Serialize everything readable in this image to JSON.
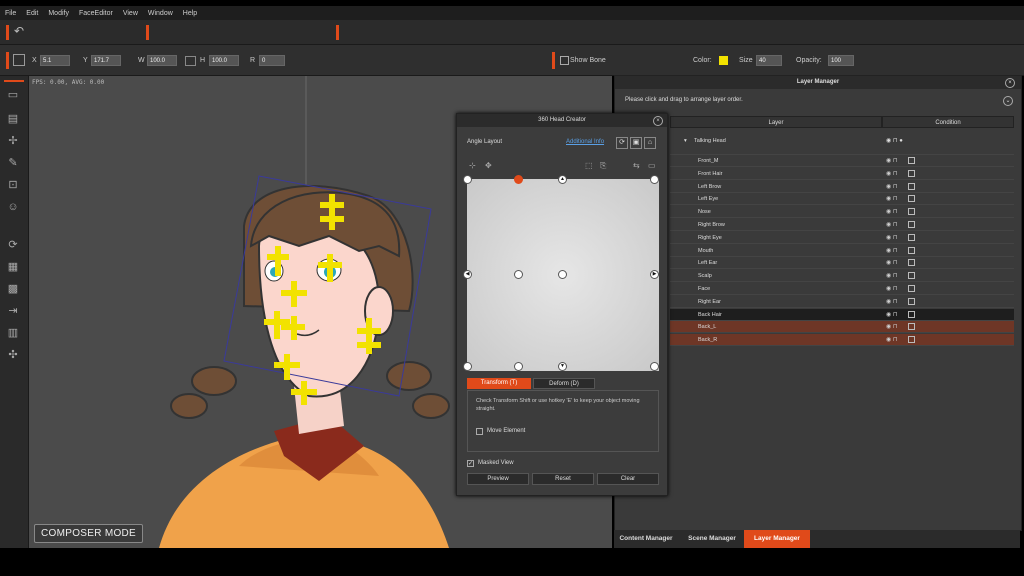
{
  "menu": [
    "File",
    "Edit",
    "Modify",
    "FaceEditor",
    "View",
    "Window",
    "Help"
  ],
  "transform": {
    "x_label": "X",
    "x_value": "5.1",
    "y_label": "Y",
    "y_value": "171.7",
    "w_label": "W",
    "w_value": "100.0",
    "h_label": "H",
    "h_value": "100.0",
    "r_label": "R",
    "r_value": "0"
  },
  "bone": {
    "show_bone_label": "Show Bone"
  },
  "style": {
    "color_label": "Color:",
    "color_value": "#f2e200",
    "size_label": "Size",
    "size_value": "40",
    "opacity_label": "Opacity:",
    "opacity_value": "100"
  },
  "viewport": {
    "fps": "FPS: 0.00, AVG: 0.00",
    "mode_label": "COMPOSER MODE"
  },
  "head_creator": {
    "title": "360 Head Creator",
    "angle_layout_label": "Angle Layout",
    "additional_info": "Additional Info",
    "tabs": {
      "transform": "Transform (T)",
      "deform": "Deform (D)"
    },
    "hint": "Check Transform Shift or use hotkey 'E' to keep your object moving straight.",
    "move_element": "Move Element",
    "masked_view": "Masked View",
    "buttons": {
      "preview": "Preview",
      "reset": "Reset",
      "clear": "Clear"
    }
  },
  "layer_manager": {
    "title": "Layer Manager",
    "hint": "Please click and drag to arrange layer order.",
    "col_layer": "Layer",
    "col_condition": "Condition",
    "group": "Talking Head",
    "layers": [
      "Front_M",
      "Front Hair",
      "Left Brow",
      "Left Eye",
      "Nose",
      "Right Brow",
      "Right Eye",
      "Mouth",
      "Left Ear",
      "Scalp",
      "Face",
      "Right Ear",
      "Back Hair",
      "Back_L",
      "Back_R"
    ]
  },
  "bottom_tabs": {
    "content": "Content Manager",
    "scene": "Scene Manager",
    "layer": "Layer Manager"
  }
}
